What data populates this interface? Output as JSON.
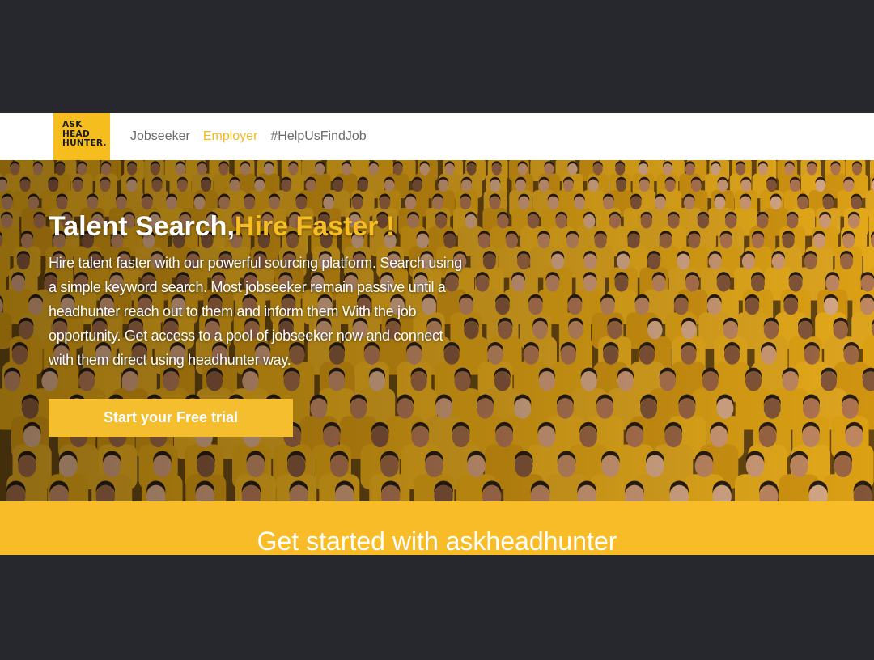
{
  "navbar": {
    "logo": {
      "line1": "ASK",
      "line2": "HEAD",
      "line3": "HUNTER."
    },
    "links": [
      {
        "label": "Jobseeker",
        "active": false
      },
      {
        "label": "Employer",
        "active": true
      },
      {
        "label": "#HelpUsFindJob",
        "active": false
      }
    ]
  },
  "hero": {
    "title_main": "Talent Search,",
    "title_accent": "Hire Faster !",
    "description": "Hire talent faster with our powerful sourcing platform. Search using a simple keyword search. Most jobseeker remain passive until a headhunter reach out to them and inform them With the job opportunity. Get access to a pool of jobseeker now and connect with them direct using headhunter way.",
    "cta_label": "Start your Free trial"
  },
  "band": {
    "title": "Get started with askheadhunter"
  },
  "colors": {
    "brand_yellow": "#f5be1e",
    "accent_text": "#f7bd25",
    "active_link": "#f5b91e",
    "band_bg": "#f8bc28",
    "letterbox": "#27282d"
  }
}
